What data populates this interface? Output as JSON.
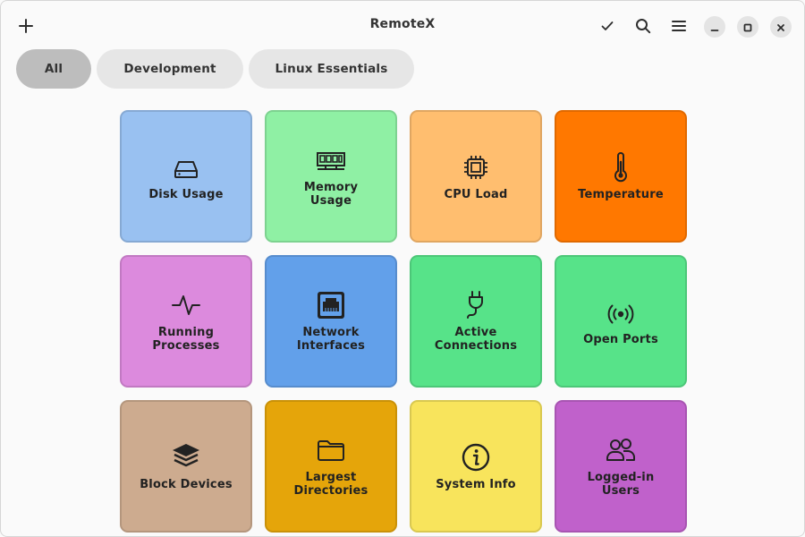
{
  "window": {
    "title": "RemoteX"
  },
  "header": {
    "left_icon": "plus-icon",
    "right_icons": [
      "checkmark-icon",
      "search-icon",
      "hamburger-menu-icon"
    ],
    "window_controls": [
      "minimize-icon",
      "maximize-icon",
      "close-icon"
    ]
  },
  "filters": {
    "chips": [
      {
        "label": "All",
        "active": true
      },
      {
        "label": "Development",
        "active": false
      },
      {
        "label": "Linux Essentials",
        "active": false
      }
    ]
  },
  "tiles": [
    {
      "label": "Disk Usage",
      "icon": "hard-drive-icon",
      "color": "#99c1f1"
    },
    {
      "label": "Memory\nUsage",
      "icon": "memory-icon",
      "color": "#8ff0a4"
    },
    {
      "label": "CPU Load",
      "icon": "cpu-chip-icon",
      "color": "#ffbe6f"
    },
    {
      "label": "Temperature",
      "icon": "thermometer-icon",
      "color": "#ff7800"
    },
    {
      "label": "Running\nProcesses",
      "icon": "activity-pulse-icon",
      "color": "#dc8add"
    },
    {
      "label": "Network\nInterfaces",
      "icon": "ethernet-port-icon",
      "color": "#62a0ea"
    },
    {
      "label": "Active\nConnections",
      "icon": "plug-icon",
      "color": "#57e389"
    },
    {
      "label": "Open Ports",
      "icon": "broadcast-signal-icon",
      "color": "#57e389"
    },
    {
      "label": "Block Devices",
      "icon": "layers-stack-icon",
      "color": "#cdab8f"
    },
    {
      "label": "Largest\nDirectories",
      "icon": "folder-icon",
      "color": "#e5a50a"
    },
    {
      "label": "System Info",
      "icon": "info-icon",
      "color": "#f8e45c"
    },
    {
      "label": "Logged-in\nUsers",
      "icon": "users-icon",
      "color": "#c061cb"
    }
  ]
}
